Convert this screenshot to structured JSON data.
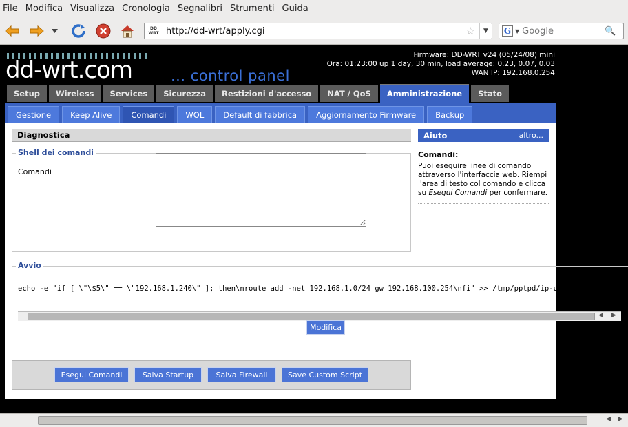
{
  "browser": {
    "menu": [
      {
        "label": "File"
      },
      {
        "label": "Modifica"
      },
      {
        "label": "Visualizza"
      },
      {
        "label": "Cronologia"
      },
      {
        "label": "Segnalibri"
      },
      {
        "label": "Strumenti"
      },
      {
        "label": "Guida"
      }
    ],
    "url": "http://dd-wrt/apply.cgi",
    "favicon_text": "DD WRT",
    "search_placeholder": "Google"
  },
  "header": {
    "logo": "dd-wrt",
    "logo_suffix": ".com",
    "control_panel": "... control panel",
    "firmware": "Firmware: DD-WRT v24 (05/24/08) mini",
    "uptime": "Ora: 01:23:00 up 1 day, 30 min, load average: 0.23, 0.07, 0.03",
    "wan_ip": "WAN IP: 192.168.0.254"
  },
  "main_tabs": [
    {
      "label": "Setup"
    },
    {
      "label": "Wireless"
    },
    {
      "label": "Services"
    },
    {
      "label": "Sicurezza"
    },
    {
      "label": "Restizioni d'accesso"
    },
    {
      "label": "NAT / QoS"
    },
    {
      "label": "Amministrazione"
    },
    {
      "label": "Stato"
    }
  ],
  "sub_tabs": [
    {
      "label": "Gestione"
    },
    {
      "label": "Keep Alive"
    },
    {
      "label": "Comandi"
    },
    {
      "label": "WOL"
    },
    {
      "label": "Default di fabbrica"
    },
    {
      "label": "Aggiornamento Firmware"
    },
    {
      "label": "Backup"
    }
  ],
  "diagnostics": {
    "title": "Diagnostica",
    "shell_legend": "Shell dei comandi",
    "commands_label": "Comandi",
    "commands_value": "",
    "startup_legend": "Avvio",
    "startup_script": "echo -e \"if [ \\\"\\$5\\\" == \\\"192.168.1.240\\\" ]; then\\nroute add -net 192.168.1.0/24 gw 192.168.100.254\\nfi\" >> /tmp/pptpd/ip-up",
    "modify_button": "Modifica"
  },
  "buttons": {
    "run": "Esegui Comandi",
    "save_startup": "Salva Startup",
    "save_firewall": "Salva Firewall",
    "save_custom": "Save Custom Script"
  },
  "help": {
    "title": "Aiuto",
    "more": "altro...",
    "section_title": "Comandi:",
    "text_1": "Puoi eseguire linee di comando attraverso l'interfaccia web. Riempi l'area di testo col comando e clicca su ",
    "text_em": "Esegui Comandi",
    "text_2": " per confermare."
  },
  "colors": {
    "accent": "#3a62c2",
    "tab_inactive": "#5b5b5b",
    "legend": "#2e4e9a"
  }
}
